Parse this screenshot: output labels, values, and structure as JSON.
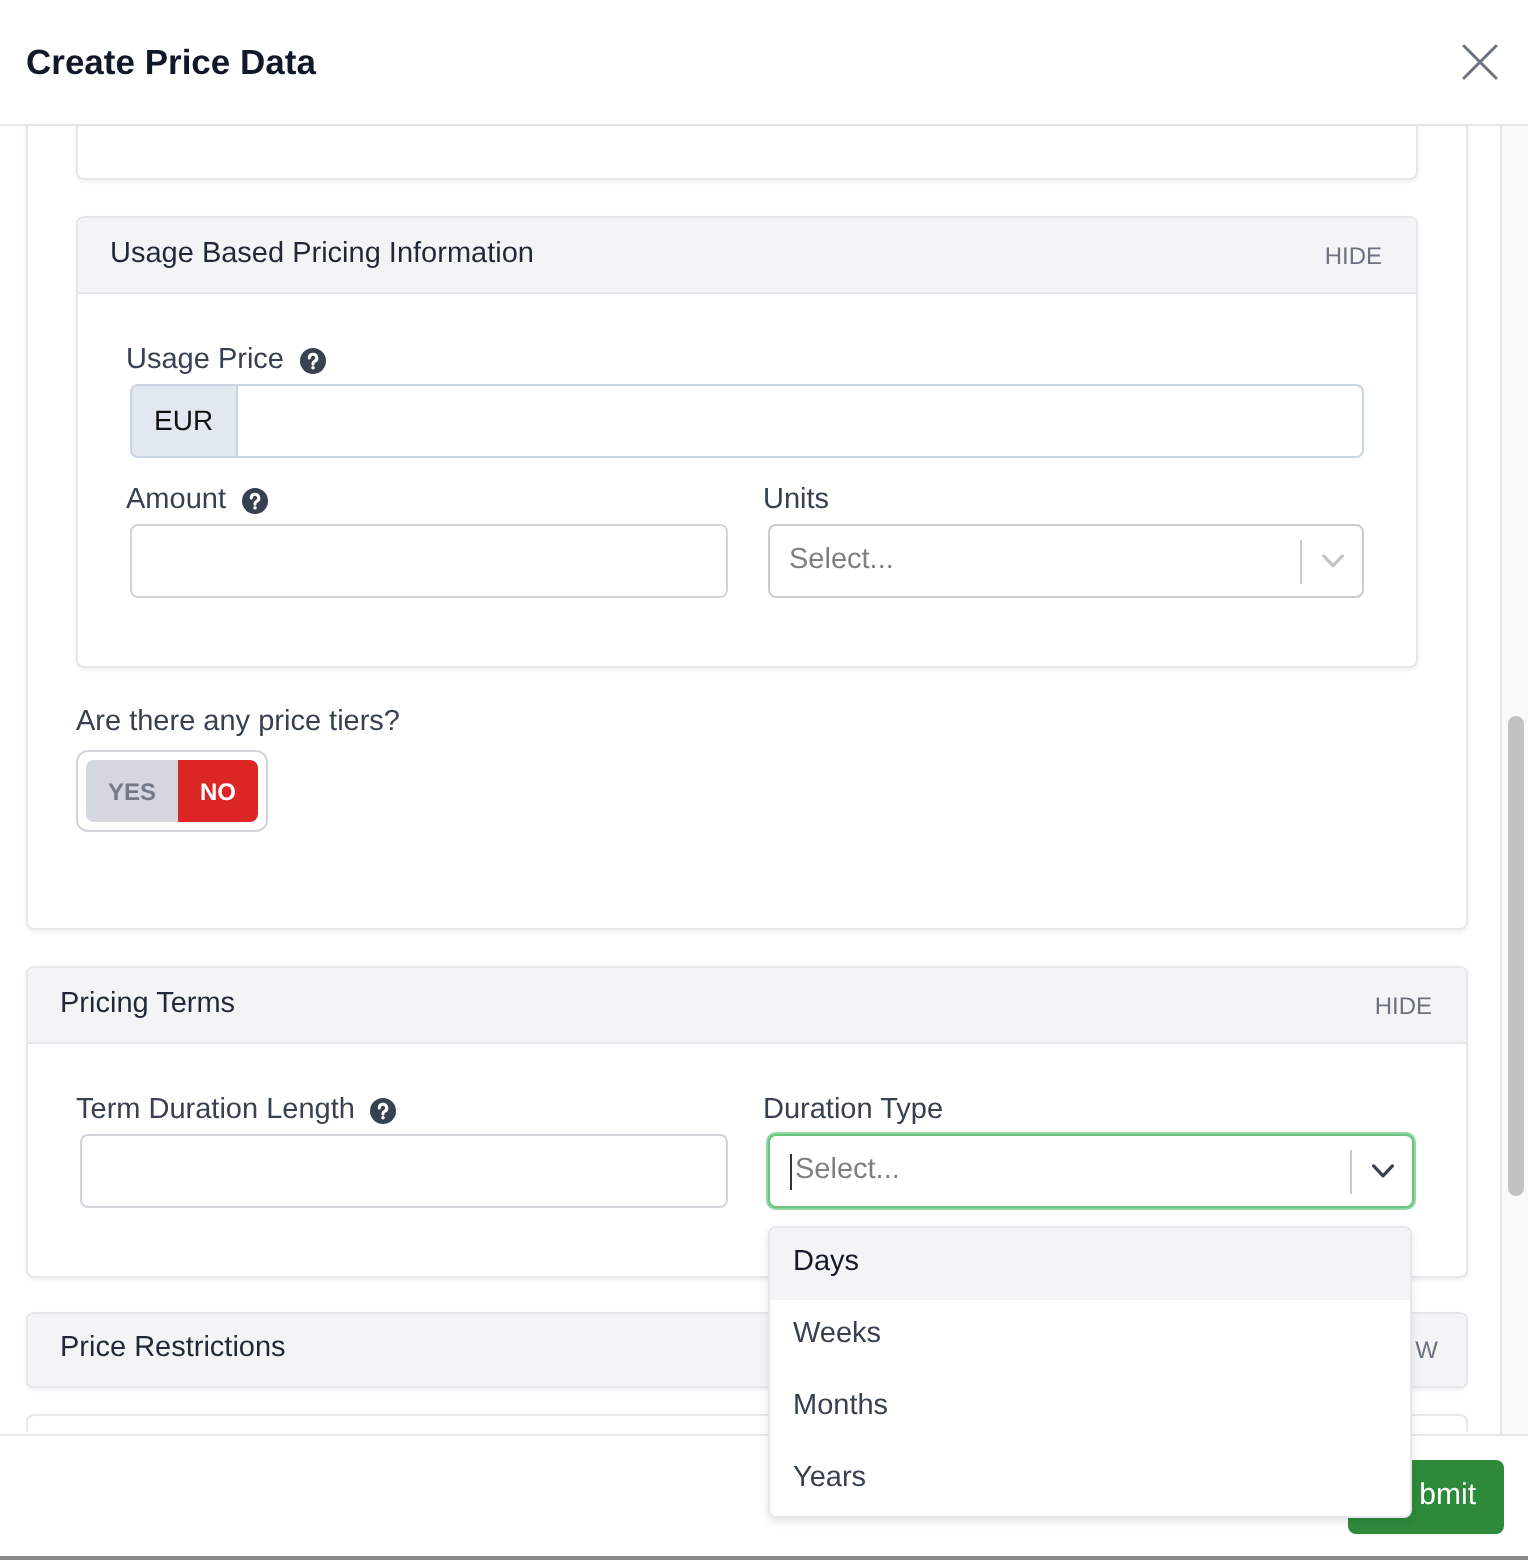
{
  "dialog": {
    "title": "Create Price Data"
  },
  "usage_pricing": {
    "title": "Usage Based Pricing Information",
    "toggle": "HIDE",
    "rows": [
      [
        {
          "kind": "currency",
          "label": "Usage Price",
          "help_icon": true,
          "addon": "EUR"
        }
      ],
      [
        {
          "kind": "text",
          "label": "Amount",
          "help_icon": true
        },
        {
          "kind": "select",
          "label": "Units",
          "help_icon": false,
          "placeholder": "Select...",
          "focused": false,
          "open": false
        }
      ]
    ]
  },
  "price_tiers": {
    "question": "Are there any price tiers?",
    "options": [
      {
        "label": "YES",
        "selected": false
      },
      {
        "label": "NO",
        "selected": true
      }
    ]
  },
  "pricing_terms": {
    "title": "Pricing Terms",
    "toggle": "HIDE",
    "rows": [
      [
        {
          "kind": "text",
          "label": "Term Duration Length",
          "help_icon": true
        },
        {
          "kind": "select",
          "label": "Duration Type",
          "help_icon": false,
          "placeholder": "Select...",
          "focused": true,
          "open": true,
          "options": [
            {
              "label": "Days",
              "selected": true
            },
            {
              "label": "Weeks",
              "selected": false
            },
            {
              "label": "Months",
              "selected": false
            },
            {
              "label": "Years",
              "selected": false
            }
          ]
        }
      ]
    ]
  },
  "price_restrictions": {
    "title": "Price Restrictions",
    "toggle": "W"
  },
  "footer": {
    "buttons": [
      "bmit"
    ]
  }
}
